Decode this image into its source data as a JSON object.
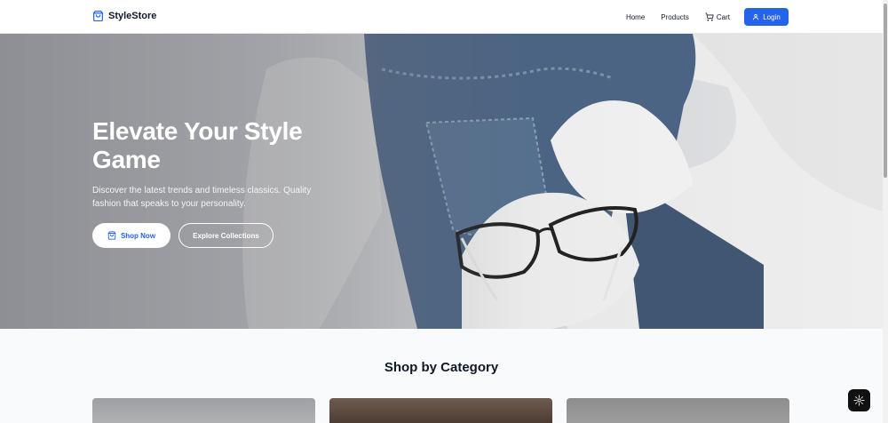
{
  "brand": {
    "name": "StyleStore",
    "icon": "shopping-bag-icon"
  },
  "nav": {
    "home": "Home",
    "products": "Products",
    "cart": "Cart",
    "login": "Login"
  },
  "hero": {
    "title": "Elevate Your Style Game",
    "subtitle": "Discover the latest trends and timeless classics. Quality fashion that speaks to your personality.",
    "primary_button": "Shop Now",
    "secondary_button": "Explore Collections"
  },
  "category": {
    "title": "Shop by Category"
  },
  "colors": {
    "accent": "#2563eb",
    "nav_bg": "#ffffff",
    "page_bg": "#f9fafb",
    "text": "#111827"
  }
}
